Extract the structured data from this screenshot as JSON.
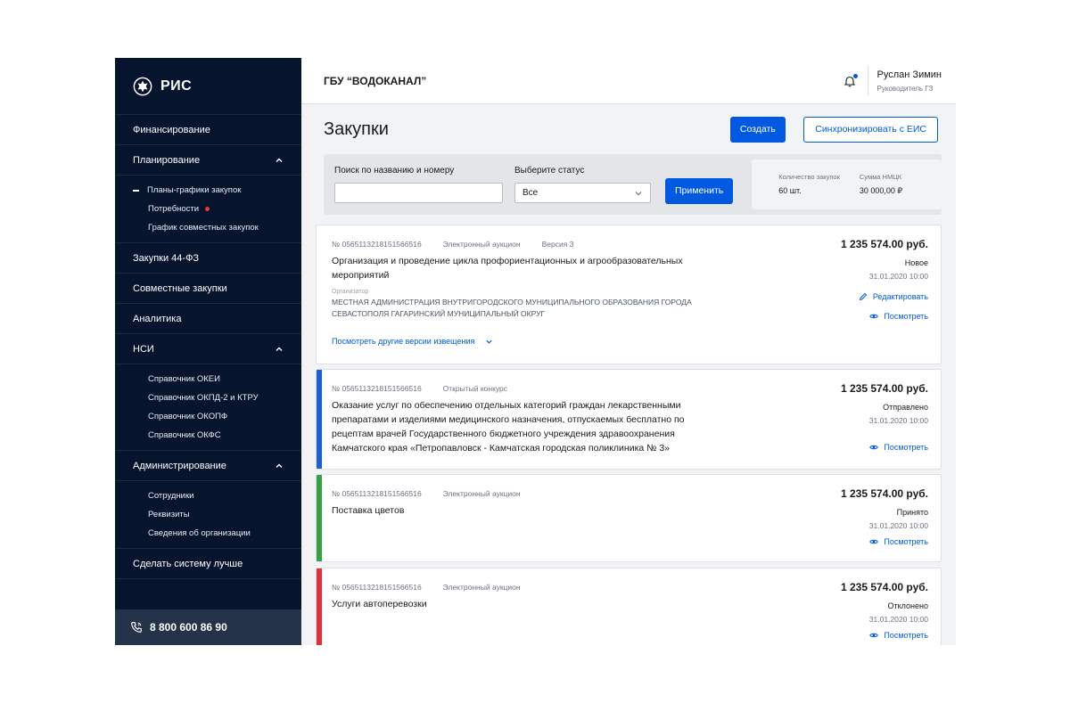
{
  "brand": {
    "name": "РИС"
  },
  "sidebar": {
    "items": [
      {
        "label": "Финансирование"
      },
      {
        "label": "Планирование"
      },
      {
        "label": "Закупки 44-ФЗ"
      },
      {
        "label": "Совместные закупки"
      },
      {
        "label": "Аналитика"
      },
      {
        "label": "НСИ"
      },
      {
        "label": "Администрирование"
      },
      {
        "label": "Сделать систему лучше"
      }
    ],
    "planning_sub": [
      {
        "label": "Планы-графики закупок"
      },
      {
        "label": "Потребности"
      },
      {
        "label": "График совместных закупок"
      }
    ],
    "nsi_sub": [
      {
        "label": "Справочник ОКЕИ"
      },
      {
        "label": "Справочник ОКПД-2 и КТРУ"
      },
      {
        "label": "Справочник ОКОПФ"
      },
      {
        "label": "Справочник ОКФС"
      }
    ],
    "admin_sub": [
      {
        "label": "Сотрудники"
      },
      {
        "label": "Реквизиты"
      },
      {
        "label": "Сведения об организации"
      }
    ],
    "phone": "8 800 600 86 90"
  },
  "header": {
    "org_name": "ГБУ “ВОДОКАНАЛ”",
    "user_name": "Руслан Зимин",
    "user_role": "Руководитель ГЗ"
  },
  "page": {
    "title": "Закупки",
    "create_label": "Создать",
    "sync_label": "Синхронизировать с ЕИС"
  },
  "filters": {
    "search_label": "Поиск по названию и номеру",
    "search_value": "",
    "status_label": "Выберите статус",
    "status_value": "Все",
    "apply_label": "Применить"
  },
  "stats": {
    "count_label": "Количество закупок",
    "count_value": "60 шт.",
    "sum_label": "Сумма НМЦК",
    "sum_value": "30 000,00 ₽"
  },
  "cards": [
    {
      "number": "№ 0565113218151566516",
      "type": "Электронный аукцион",
      "version": "Версия 3",
      "title": "Организация и проведение цикла профориентационных и агрообразовательных мероприятий",
      "org_label": "Организатор",
      "org_name": "Местная администрация внутригородского муниципального образования города Севастополя Гагаринский муниципальный округ",
      "versions_link": "Посмотреть другие версии извещения",
      "price": "1 235 574.00 руб.",
      "status": "Новое",
      "date": "31.01.2020 10:00",
      "edit_label": "Редактировать",
      "view_label": "Посмотреть"
    },
    {
      "number": "№ 0565113218151566516",
      "type": "Открытый конкурс",
      "title": "Оказание услуг по обеспечению отдельных категорий граждан лекарственными препаратами и изделиями медицинского назначения, отпускаемых бесплатно по рецептам врачей Государственного бюджетного учреждения здравоохранения Камчатского края «Петропавловск - Камчатская городская поликлиника № 3»",
      "price": "1 235 574.00 руб.",
      "status": "Отправлено",
      "date": "31.01.2020 10:00",
      "view_label": "Посмотреть",
      "stripe_color": "#1d5fd6"
    },
    {
      "number": "№ 0565113218151566516",
      "type": "Электронный аукцион",
      "title": "Поставка цветов",
      "price": "1 235 574.00 руб.",
      "status": "Принято",
      "date": "31.01.2020 10:00",
      "view_label": "Посмотреть",
      "stripe_color": "#3aa048"
    },
    {
      "number": "№ 0565113218151566516",
      "type": "Электронный аукцион",
      "title": "Услуги автоперевозки",
      "price": "1 235 574.00 руб.",
      "status": "Отклонено",
      "date": "31.01.2020 10:00",
      "view_label": "Посмотреть",
      "stripe_color": "#e0303a"
    }
  ]
}
